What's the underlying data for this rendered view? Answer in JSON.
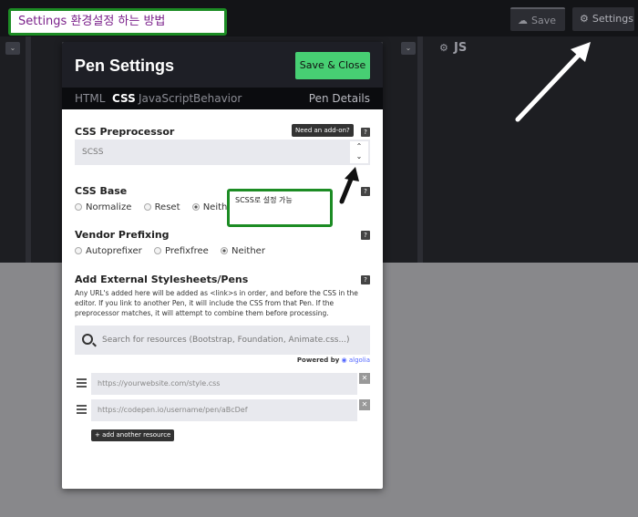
{
  "annotation": {
    "title": "Settings 환경설정 하는 방법",
    "note": "SCSS로 설정 가능"
  },
  "topbar": {
    "save_label": "Save",
    "settings_label": "Settings"
  },
  "editor": {
    "js_label": "JS"
  },
  "modal": {
    "title": "Pen Settings",
    "save_close_label": "Save & Close",
    "tabs": [
      "HTML",
      "CSS",
      "JavaScript",
      "Behavior"
    ],
    "active_tab": "CSS",
    "pen_details_label": "Pen Details",
    "preprocessor": {
      "label": "CSS Preprocessor",
      "addon_label": "Need an add-on?",
      "selected": "SCSS"
    },
    "base": {
      "label": "CSS Base",
      "options": [
        "Normalize",
        "Reset",
        "Neither"
      ],
      "selected": "Neither"
    },
    "prefixing": {
      "label": "Vendor Prefixing",
      "options": [
        "Autoprefixer",
        "Prefixfree",
        "Neither"
      ],
      "selected": "Neither"
    },
    "external": {
      "label": "Add External Stylesheets/Pens",
      "description": "Any URL's added here will be added as <link>s in order, and before the CSS in the editor. If you link to another Pen, it will include the CSS from that Pen. If the preprocessor matches, it will attempt to combine them before processing.",
      "search_placeholder": "Search for resources (Bootstrap, Foundation, Animate.css...)",
      "powered_by": "Powered by",
      "powered_brand": "algolia",
      "resources": [
        "https://yourwebsite.com/style.css",
        "https://codepen.io/username/pen/aBcDef"
      ],
      "add_label": "+ add another resource"
    }
  },
  "colors": {
    "accent": "#47cf73",
    "annotation_border": "#1c8c24",
    "annotation_text": "#7a1f8a"
  }
}
